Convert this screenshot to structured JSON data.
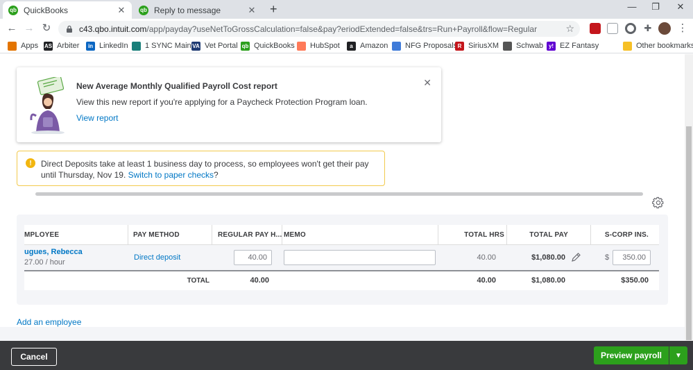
{
  "browser": {
    "tabs": [
      {
        "title": "QuickBooks",
        "close": "✕"
      },
      {
        "title": "Reply to message",
        "close": "✕"
      }
    ],
    "new_tab": "+",
    "window_controls": {
      "minimize": "—",
      "restore": "❐",
      "close": "✕"
    },
    "url_domain": "c43.qbo.intuit.com",
    "url_path": "/app/payday?useNetToGrossCalculation=false&pay?eriodExtended=false&trs=Run+Payroll&flow=Regular",
    "bookmarks": [
      {
        "label": "Apps",
        "color": "#e37400"
      },
      {
        "label": "Arbiter",
        "color": "#202124",
        "glyph": "AS"
      },
      {
        "label": "LinkedIn",
        "color": "#0a66c2",
        "glyph": "in"
      },
      {
        "label": "1 SYNC Main",
        "color": "#1a7f7a"
      },
      {
        "label": "Vet Portal",
        "color": "#1f3b73",
        "glyph": "VA"
      },
      {
        "label": "QuickBooks",
        "color": "#2ca01c",
        "glyph": "qb"
      },
      {
        "label": "HubSpot",
        "color": "#ff7a59"
      },
      {
        "label": "Amazon",
        "color": "#202124",
        "glyph": "a"
      },
      {
        "label": "NFG Proposals",
        "color": "#3f7bd9"
      },
      {
        "label": "SiriusXM",
        "color": "#c4161c",
        "glyph": "R"
      },
      {
        "label": "Schwab",
        "color": "#555"
      },
      {
        "label": "EZ Fantasy",
        "color": "#6001d2",
        "glyph": "y!"
      },
      {
        "label": "Other bookmarks",
        "color": "#f6c026"
      }
    ]
  },
  "notice": {
    "title": "New Average Monthly Qualified Payroll Cost report",
    "description": "View this new report if you're applying for a Paycheck Protection Program loan.",
    "link": "View report",
    "close": "✕"
  },
  "alert": {
    "text": "Direct Deposits take at least 1 business day to process, so employees won't get their pay until Thursday, Nov 19.",
    "link": "Switch to paper checks",
    "suffix": "?"
  },
  "table": {
    "columns": {
      "employee": "MPLOYEE",
      "pay_method": "PAY METHOD",
      "regular_pay": "REGULAR PAY H...",
      "memo": "MEMO",
      "total_hrs": "TOTAL HRS",
      "total_pay": "TOTAL PAY",
      "scorp": "S-CORP INS."
    },
    "row": {
      "employee_name": "ugues, Rebecca",
      "rate": "27.00 / hour",
      "pay_method": "Direct deposit",
      "regular_hours": "40.00",
      "memo": "",
      "total_hrs": "40.00",
      "total_pay": "$1,080.00",
      "currency": "$",
      "scorp_value": "350.00"
    },
    "totals": {
      "label": "TOTAL",
      "regular_hours": "40.00",
      "total_hrs": "40.00",
      "total_pay": "$1,080.00",
      "scorp": "$350.00"
    }
  },
  "add_employee": "Add an employee",
  "footer": {
    "cancel": "Cancel",
    "preview": "Preview payroll",
    "split_arrow": "▼"
  },
  "colors": {
    "accent_green": "#2ca01c",
    "link_blue": "#0077c5",
    "footer_bg": "#393a3d",
    "alert_border": "#f2c94c"
  }
}
